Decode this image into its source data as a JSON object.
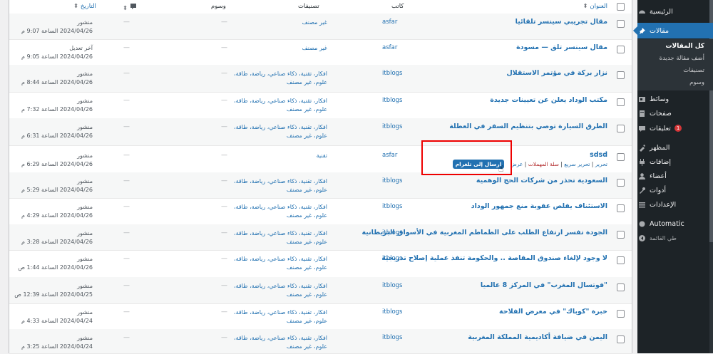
{
  "sidebar": {
    "items": [
      {
        "label": "الرئيسية",
        "icon": "dashboard-icon"
      },
      {
        "label": "مقالات",
        "icon": "pin-icon"
      },
      {
        "label": "وسائط",
        "icon": "media-icon"
      },
      {
        "label": "صفحات",
        "icon": "pages-icon"
      },
      {
        "label": "تعليقات",
        "icon": "comments-icon",
        "badge": "1"
      },
      {
        "label": "المظهر",
        "icon": "appearance-icon"
      },
      {
        "label": "إضافات",
        "icon": "plugins-icon"
      },
      {
        "label": "أعضاء",
        "icon": "users-icon"
      },
      {
        "label": "أدوات",
        "icon": "tools-icon"
      },
      {
        "label": "الإعدادات",
        "icon": "settings-icon"
      },
      {
        "label": "Automatic",
        "icon": "automatic-icon"
      },
      {
        "label": "طي القائمة",
        "icon": "collapse-icon"
      }
    ],
    "submenu": [
      "كل المقالات",
      "أضف مقالة جديدة",
      "تصنيفات",
      "وسوم"
    ]
  },
  "table": {
    "headers": {
      "title": "العنوان",
      "author": "كاتب",
      "categories": "تصنيفات",
      "tags": "وسوم",
      "comments_icon": "comment-bubble-icon",
      "date": "التاريخ"
    },
    "rows": [
      {
        "title": "مقال تجريبي سينسر تلقائيا",
        "author": "asfar",
        "cats1": "غير مصنف",
        "cats2": "",
        "tags": "—",
        "comments": "—",
        "status": "منشور",
        "date": "2024/04/26 الساعة 9:07 م"
      },
      {
        "title": "مقال سينسر تلق — مسودة",
        "author": "asfar",
        "cats1": "غير مصنف",
        "cats2": "",
        "tags": "—",
        "comments": "—",
        "status": "آخر تعديل",
        "date": "2024/04/26 الساعة 9:05 م"
      },
      {
        "title": "نزار بركة في مؤتمر الاستقلال",
        "author": "itblogs",
        "cats1": "افكار، تقنية، ذكاء صناعي، رياضة، طاقة،",
        "cats2": "علوم، غير مصنف",
        "tags": "—",
        "comments": "—",
        "status": "منشور",
        "date": "2024/04/26 الساعة 8:44 م"
      },
      {
        "title": "مكتب الوداد يعلن عن تعيينات جديدة",
        "author": "itblogs",
        "cats1": "افكار، تقنية، ذكاء صناعي، رياضة، طاقة،",
        "cats2": "علوم، غير مصنف",
        "tags": "—",
        "comments": "—",
        "status": "منشور",
        "date": "2024/04/26 الساعة 7:32 م"
      },
      {
        "title": "الطرق السيارة توصي بتنظيم السفر في العطلة",
        "author": "itblogs",
        "cats1": "افكار، تقنية، ذكاء صناعي، رياضة، طاقة،",
        "cats2": "علوم، غير مصنف",
        "tags": "—",
        "comments": "—",
        "status": "منشور",
        "date": "2024/04/26 الساعة 6:31 م"
      },
      {
        "title": "sdsd",
        "author": "asfar",
        "cats1": "تقنية",
        "cats2": "",
        "tags": "—",
        "comments": "—",
        "status": "منشور",
        "date": "2024/04/26 الساعة 6:29 م",
        "actions": {
          "edit": "تحرير",
          "quick": "تحرير سريع",
          "trash": "سلة المهملات",
          "view": "عرض",
          "telegram": "ارسال إلى تلغرام"
        }
      },
      {
        "title": "السعودية تحذر من شركات الحج الوهمية",
        "author": "itblogs",
        "cats1": "افكار، تقنية، ذكاء صناعي، رياضة، طاقة،",
        "cats2": "علوم، غير مصنف",
        "tags": "—",
        "comments": "—",
        "status": "منشور",
        "date": "2024/04/26 الساعة 5:29 م"
      },
      {
        "title": "الاستئناف يقلص عقوبة منع جمهور الوداد",
        "author": "itblogs",
        "cats1": "افكار، تقنية، ذكاء صناعي، رياضة، طاقة،",
        "cats2": "علوم، غير مصنف",
        "tags": "—",
        "comments": "—",
        "status": "منشور",
        "date": "2024/04/26 الساعة 4:29 م"
      },
      {
        "title": "الجودة تفسر ارتفاع الطلب على الطماطم المغربية في الأسواق البريطانية",
        "author": "itblogs",
        "cats1": "افكار، تقنية، ذكاء صناعي، رياضة، طاقة،",
        "cats2": "علوم، غير مصنف",
        "tags": "—",
        "comments": "—",
        "status": "منشور",
        "date": "2024/04/26 الساعة 3:28 م"
      },
      {
        "title": "لا وجود لإلغاء صندوق المقاصة .. والحكومة تنفذ عملية إصلاح تدريجية",
        "author": "itblogs",
        "cats1": "افكار، تقنية، ذكاء صناعي، رياضة، طاقة،",
        "cats2": "علوم، غير مصنف",
        "tags": "—",
        "comments": "—",
        "status": "منشور",
        "date": "2024/04/26 الساعة 1:44 ص"
      },
      {
        "title": "\"فوتسال المغرب\" في المركز 8 عالميا",
        "author": "itblogs",
        "cats1": "افكار، تقنية، ذكاء صناعي، رياضة، طاقة،",
        "cats2": "علوم، غير مصنف",
        "tags": "—",
        "comments": "—",
        "status": "منشور",
        "date": "2024/04/25 الساعة 12:39 ص"
      },
      {
        "title": "خبرة \"كوباك\" في معرض الفلاحة",
        "author": "itblogs",
        "cats1": "افكار، تقنية، ذكاء صناعي، رياضة، طاقة،",
        "cats2": "علوم، غير مصنف",
        "tags": "—",
        "comments": "—",
        "status": "منشور",
        "date": "2024/04/24 الساعة 4:33 م"
      },
      {
        "title": "اليمن في ضيافة أكاديمية المملكة المغربية",
        "author": "itblogs",
        "cats1": "افكار، تقنية، ذكاء صناعي، رياضة، طاقة،",
        "cats2": "علوم، غير مصنف",
        "tags": "—",
        "comments": "—",
        "status": "منشور",
        "date": "2024/04/24 الساعة 3:25 م"
      }
    ]
  }
}
